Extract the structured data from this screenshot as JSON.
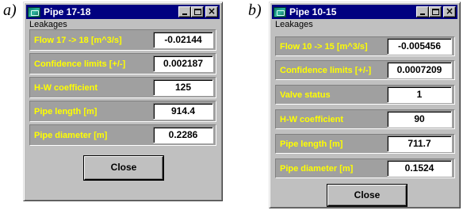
{
  "windows": [
    {
      "tag": "a)",
      "title": "Pipe 17-18",
      "menu": "Leakages",
      "rows": [
        {
          "label": "Flow 17 -> 18 [m^3/s]",
          "value": "-0.02144"
        },
        {
          "label": "Confidence limits [+/-]",
          "value": "0.002187"
        },
        {
          "label": "H-W coefficient",
          "value": "125"
        },
        {
          "label": "Pipe length [m]",
          "value": "914.4"
        },
        {
          "label": "Pipe diameter [m]",
          "value": "0.2286"
        }
      ],
      "close_label": "Close"
    },
    {
      "tag": "b)",
      "title": "Pipe 10-15",
      "menu": "Leakages",
      "rows": [
        {
          "label": "Flow 10 -> 15 [m^3/s]",
          "value": "-0.005456"
        },
        {
          "label": "Confidence limits [+/-]",
          "value": "0.0007209"
        },
        {
          "label": "Valve status",
          "value": "1"
        },
        {
          "label": "H-W coefficient",
          "value": "90"
        },
        {
          "label": "Pipe length [m]",
          "value": "711.7"
        },
        {
          "label": "Pipe diameter [m]",
          "value": "0.1524"
        }
      ],
      "close_label": "Close"
    }
  ],
  "icons": {
    "title_icon": "app-icon",
    "minimize": "minimize-icon",
    "maximize": "maximize-icon",
    "close": "close-icon"
  },
  "colors": {
    "titlebar": "#000080",
    "window": "#c0c0c0",
    "row_background": "#a0a0a0",
    "row_label": "#ffff00",
    "value_box": "#ffffff"
  }
}
